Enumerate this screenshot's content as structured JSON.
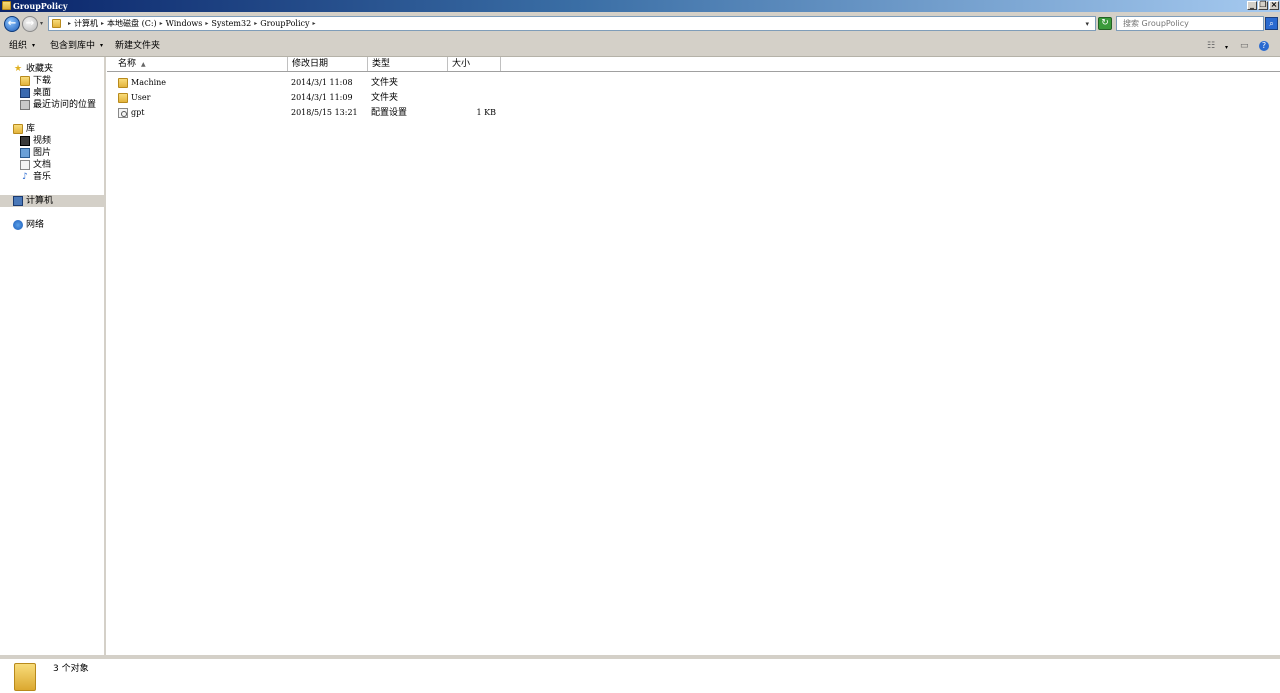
{
  "window": {
    "title": "GroupPolicy",
    "folder_icon": "folder-icon"
  },
  "window_buttons": {
    "minimize": "_",
    "restore": "❐",
    "close": "×"
  },
  "nav_buttons": {
    "back": "←",
    "forward": "→",
    "history": "▾"
  },
  "address": {
    "crumbs": [
      "计算机",
      "本地磁盘 (C:)",
      "Windows",
      "System32",
      "GroupPolicy"
    ],
    "separator": "▸",
    "dropdown": "▾"
  },
  "refresh": {
    "glyph": "↻"
  },
  "search": {
    "placeholder": "搜索 GroupPolicy",
    "button_glyph": "⌕"
  },
  "toolbar": {
    "organize": "组织",
    "include_in_library": "包含到库中",
    "new_folder": "新建文件夹",
    "dropdown": "▾",
    "view_glyph": "☷",
    "view_dropdown": "▾",
    "preview_glyph": "▭",
    "help_glyph": "?"
  },
  "sidebar": {
    "favorites": {
      "label": "收藏夹",
      "icon": "star-icon"
    },
    "favorites_items": [
      {
        "label": "下载",
        "icon": "download-folder-icon"
      },
      {
        "label": "桌面",
        "icon": "desktop-icon"
      },
      {
        "label": "最近访问的位置",
        "icon": "recent-places-icon"
      }
    ],
    "libraries": {
      "label": "库",
      "icon": "library-icon"
    },
    "library_items": [
      {
        "label": "视频",
        "icon": "video-icon"
      },
      {
        "label": "图片",
        "icon": "picture-icon"
      },
      {
        "label": "文档",
        "icon": "document-icon"
      },
      {
        "label": "音乐",
        "icon": "music-icon"
      }
    ],
    "computer": {
      "label": "计算机",
      "icon": "computer-icon"
    },
    "network": {
      "label": "网络",
      "icon": "network-icon"
    }
  },
  "columns": {
    "name": "名称",
    "date": "修改日期",
    "type": "类型",
    "size": "大小",
    "sort_glyph": "▲"
  },
  "files": [
    {
      "name": "Machine",
      "date": "2014/3/1 11:08",
      "type": "文件夹",
      "size": "",
      "icon": "folder-icon"
    },
    {
      "name": "User",
      "date": "2014/3/1 11:09",
      "type": "文件夹",
      "size": "",
      "icon": "folder-icon"
    },
    {
      "name": "gpt",
      "date": "2018/5/15 13:21",
      "type": "配置设置",
      "size": "1 KB",
      "icon": "settings-file-icon"
    }
  ],
  "status": {
    "text": "3 个对象"
  },
  "colors": {
    "chrome": "#d4d0c8",
    "title_start": "#0a246a",
    "title_end": "#a6caf0",
    "selection": "#d4d0c8"
  }
}
